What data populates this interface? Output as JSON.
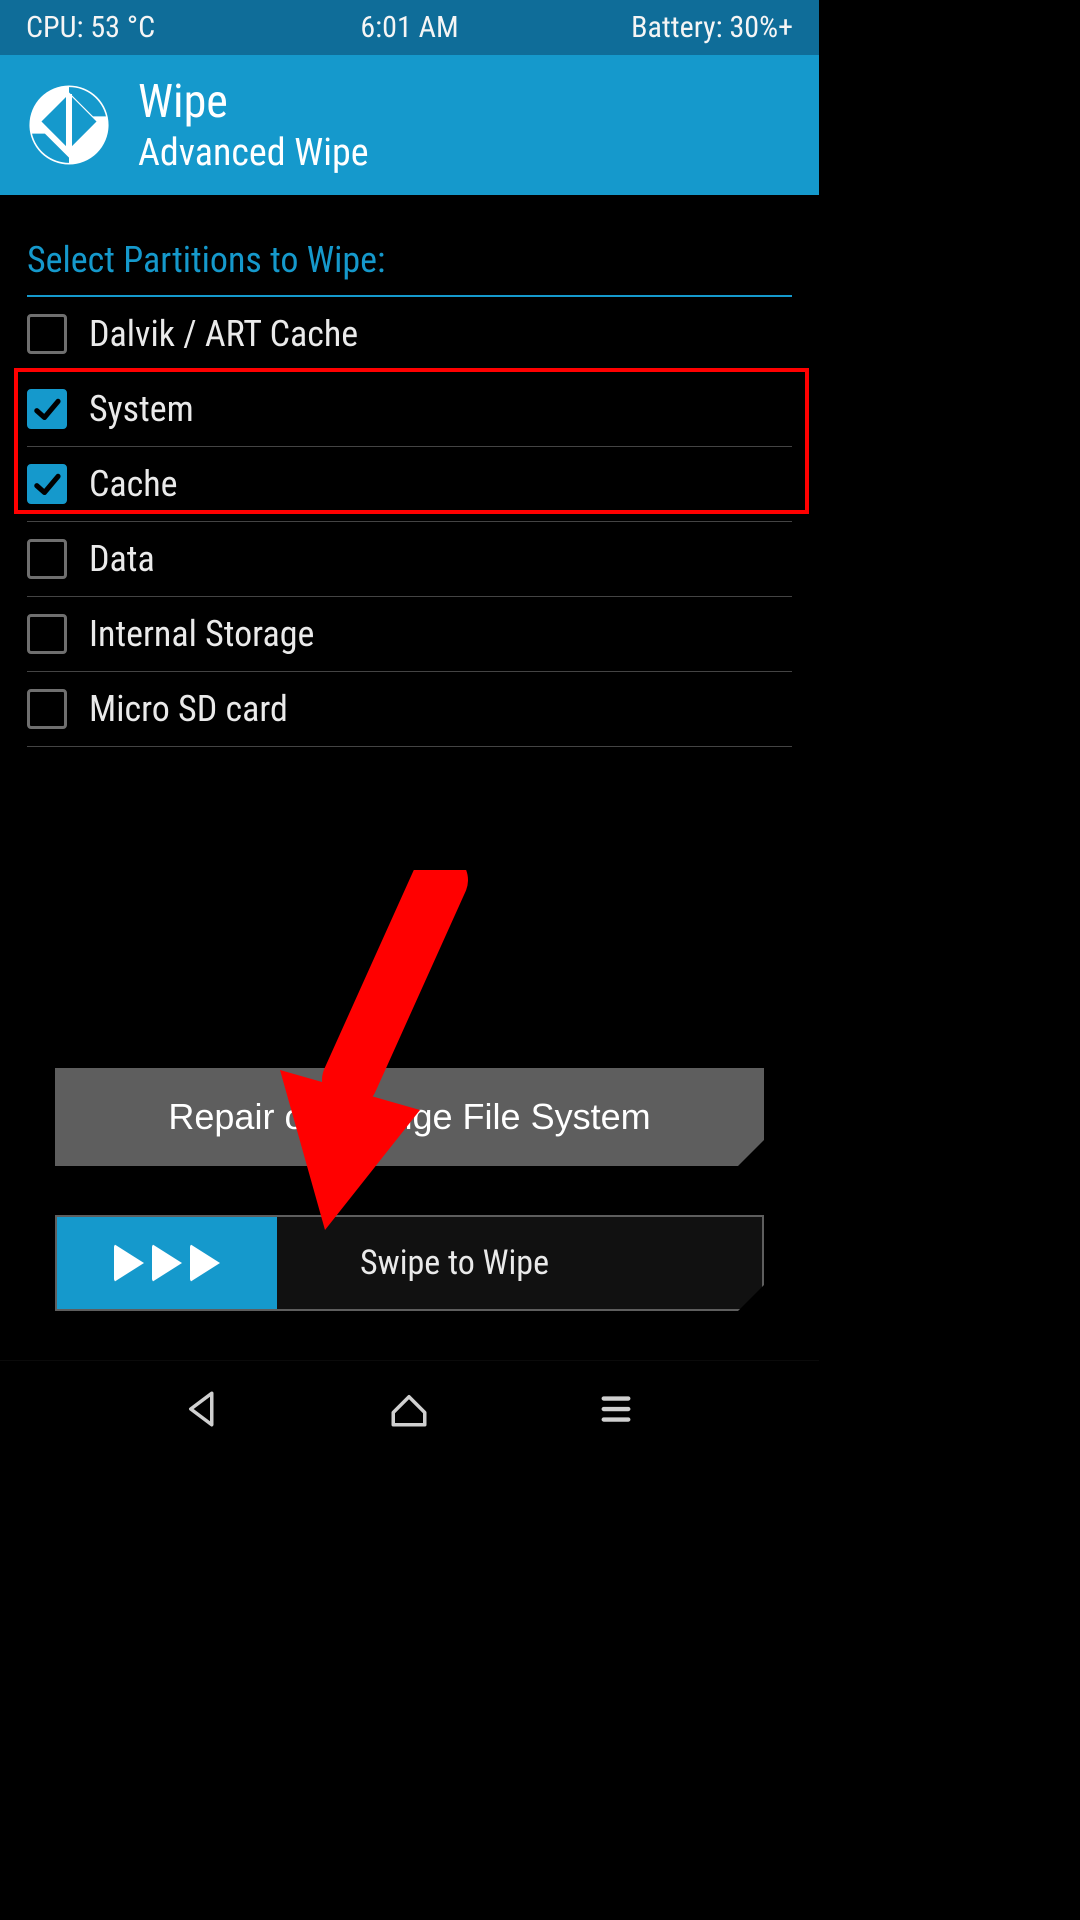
{
  "status": {
    "cpu": "CPU: 53 °C",
    "time": "6:01 AM",
    "battery": "Battery: 30%+"
  },
  "header": {
    "title": "Wipe",
    "subtitle": "Advanced Wipe"
  },
  "section_label": "Select Partitions to Wipe:",
  "partitions": [
    {
      "label": "Dalvik / ART Cache",
      "checked": false
    },
    {
      "label": "System",
      "checked": true
    },
    {
      "label": "Cache",
      "checked": true
    },
    {
      "label": "Data",
      "checked": false
    },
    {
      "label": "Internal Storage",
      "checked": false
    },
    {
      "label": "Micro SD card",
      "checked": false
    }
  ],
  "buttons": {
    "repair": "Repair or Change File System",
    "swipe": "Swipe to Wipe"
  },
  "colors": {
    "accent": "#1599cc",
    "status_bg": "#0f6d99",
    "annotation": "#ff0000"
  },
  "annotation": {
    "highlighted_indices": [
      1,
      2
    ],
    "arrow_points_to": "swipe-slider"
  }
}
